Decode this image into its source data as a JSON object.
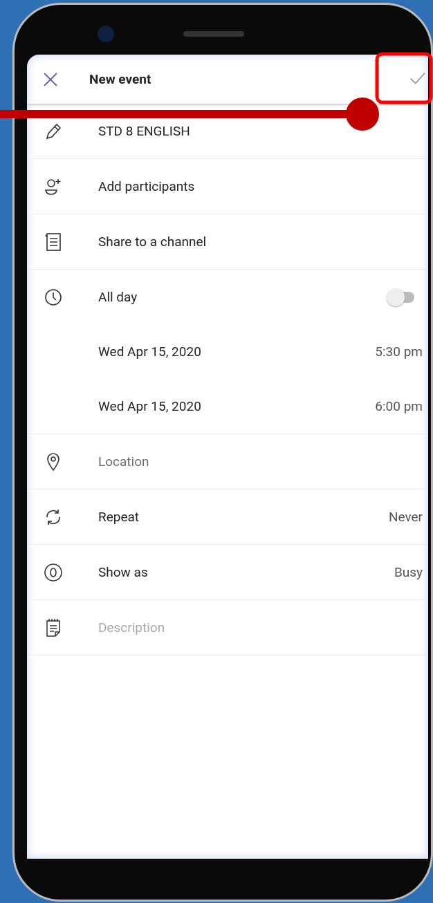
{
  "header": {
    "title": "New event"
  },
  "event_title": {
    "value": "STD 8 ENGLISH"
  },
  "rows": [
    {
      "kind": "action",
      "label": "Add participants"
    },
    {
      "kind": "action",
      "label": "Share to a channel"
    },
    {
      "kind": "toggle",
      "label": "All day",
      "on": false
    },
    {
      "kind": "datetime",
      "date": "Wed Apr 15, 2020",
      "time": "5:30 pm"
    },
    {
      "kind": "datetime",
      "date": "Wed Apr 15, 2020",
      "time": "6:00 pm"
    },
    {
      "kind": "field",
      "placeholder": "Location"
    },
    {
      "kind": "option",
      "label": "Repeat",
      "value": "Never"
    },
    {
      "kind": "option",
      "label": "Show as",
      "value": "Busy"
    },
    {
      "kind": "field",
      "placeholder": "Description"
    }
  ]
}
